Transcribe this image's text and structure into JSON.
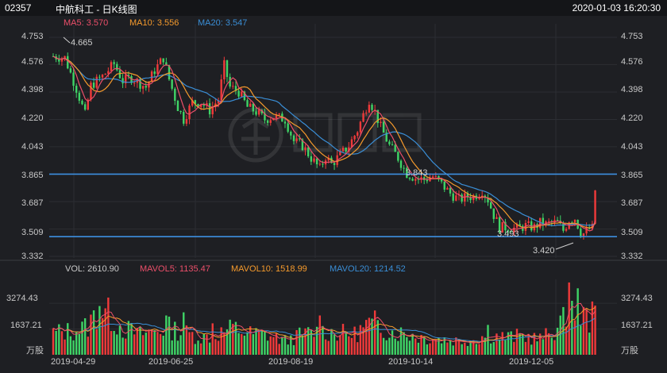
{
  "header": {
    "code": "02357",
    "name": "中航科工 - 日K线图",
    "datetime": "2020-01-03 16:20:30"
  },
  "indicators": {
    "ma5": "MA5: 3.570",
    "ma10": "MA10: 3.556",
    "ma20": "MA20: 3.547",
    "vol": "VOL: 2610.90",
    "mavol5": "MAVOL5: 1135.47",
    "mavol10": "MAVOL10: 1518.99",
    "mavol20": "MAVOL20: 1214.52"
  },
  "colors": {
    "up": "#f03a3a",
    "down": "#3fd466",
    "ma5": "#ec4f6a",
    "ma10": "#f59a2c",
    "ma20": "#3a8ed6",
    "hline": "#3d8fe0",
    "background": "#1e1f23"
  },
  "chart_data": {
    "type": "candlestick",
    "price_axis": {
      "ticks": [
        "4.753",
        "4.576",
        "4.398",
        "4.220",
        "4.043",
        "3.865",
        "3.687",
        "3.509",
        "3.332"
      ],
      "ylim": [
        3.332,
        4.753
      ]
    },
    "volume_axis": {
      "ticks": [
        "3274.43",
        "1637.21"
      ],
      "unit": "万股",
      "ylim": [
        0,
        4900
      ]
    },
    "x_ticks": [
      "2019-04-29",
      "2019-06-25",
      "2019-08-19",
      "2019-10-14",
      "2019-12-05"
    ],
    "horizontal_lines": [
      3.865,
      3.46
    ],
    "annotations": {
      "high": "4.665",
      "low": "3.420",
      "mid1": "3.843",
      "mid2": "3.493"
    },
    "price_path": [
      [
        0,
        4.63
      ],
      [
        4,
        4.62
      ],
      [
        8,
        4.42
      ],
      [
        11,
        4.25
      ],
      [
        13,
        4.44
      ],
      [
        17,
        4.5
      ],
      [
        21,
        4.58
      ],
      [
        24,
        4.47
      ],
      [
        27,
        4.49
      ],
      [
        32,
        4.43
      ],
      [
        35,
        4.54
      ],
      [
        38,
        4.62
      ],
      [
        40,
        4.48
      ],
      [
        43,
        4.3
      ],
      [
        45,
        4.22
      ],
      [
        48,
        4.33
      ],
      [
        51,
        4.33
      ],
      [
        54,
        4.28
      ],
      [
        57,
        4.35
      ],
      [
        59,
        4.57
      ],
      [
        61,
        4.43
      ],
      [
        64,
        4.4
      ],
      [
        67,
        4.3
      ],
      [
        70,
        4.27
      ],
      [
        73,
        4.22
      ],
      [
        76,
        4.24
      ],
      [
        80,
        4.22
      ],
      [
        83,
        4.08
      ],
      [
        86,
        4.05
      ],
      [
        89,
        3.97
      ],
      [
        92,
        3.9
      ],
      [
        94,
        3.98
      ],
      [
        96,
        3.93
      ],
      [
        99,
        3.99
      ],
      [
        102,
        4.05
      ],
      [
        105,
        4.15
      ],
      [
        107,
        4.25
      ],
      [
        109,
        4.35
      ],
      [
        111,
        4.27
      ],
      [
        113,
        4.17
      ],
      [
        116,
        4.05
      ],
      [
        119,
        3.97
      ],
      [
        122,
        3.87
      ],
      [
        125,
        3.84
      ],
      [
        128,
        3.83
      ],
      [
        131,
        3.85
      ],
      [
        134,
        3.8
      ],
      [
        137,
        3.74
      ],
      [
        140,
        3.7
      ],
      [
        143,
        3.72
      ],
      [
        145,
        3.72
      ],
      [
        148,
        3.76
      ],
      [
        150,
        3.7
      ],
      [
        152,
        3.6
      ],
      [
        154,
        3.52
      ],
      [
        157,
        3.52
      ],
      [
        160,
        3.51
      ],
      [
        163,
        3.53
      ],
      [
        166,
        3.52
      ],
      [
        168,
        3.55
      ],
      [
        170,
        3.54
      ],
      [
        172,
        3.55
      ],
      [
        174,
        3.55
      ],
      [
        176,
        3.5
      ],
      [
        178,
        3.57
      ],
      [
        180,
        3.58
      ],
      [
        182,
        3.49
      ],
      [
        183,
        3.48
      ],
      [
        185,
        3.51
      ],
      [
        187,
        3.52
      ]
    ],
    "volume_path": [
      [
        0,
        1400
      ],
      [
        8,
        1550
      ],
      [
        12,
        1800
      ],
      [
        16,
        3000
      ],
      [
        20,
        2400
      ],
      [
        24,
        1700
      ],
      [
        30,
        1300
      ],
      [
        36,
        1600
      ],
      [
        40,
        1700
      ],
      [
        45,
        1400
      ],
      [
        52,
        1100
      ],
      [
        58,
        1400
      ],
      [
        62,
        1700
      ],
      [
        68,
        1350
      ],
      [
        74,
        1250
      ],
      [
        80,
        900
      ],
      [
        86,
        1300
      ],
      [
        92,
        1500
      ],
      [
        98,
        1400
      ],
      [
        104,
        1300
      ],
      [
        110,
        2100
      ],
      [
        116,
        1500
      ],
      [
        122,
        1350
      ],
      [
        128,
        1100
      ],
      [
        134,
        1000
      ],
      [
        140,
        900
      ],
      [
        146,
        1000
      ],
      [
        150,
        1300
      ],
      [
        156,
        1100
      ],
      [
        162,
        1200
      ],
      [
        168,
        1000
      ],
      [
        172,
        1400
      ],
      [
        176,
        2100
      ],
      [
        179,
        4600
      ],
      [
        181,
        3300
      ],
      [
        184,
        1700
      ],
      [
        187,
        2700
      ]
    ],
    "volume_spikes": {
      "16": 3100,
      "39": 2500,
      "45": 2700,
      "55": 2000,
      "92": 2500,
      "110": 2300,
      "150": 1900,
      "178": 4600,
      "180": 2200,
      "184": 2900
    },
    "ma_offsets": {
      "ma5": 0.0,
      "ma10": 0.035,
      "ma20": 0.075
    }
  }
}
